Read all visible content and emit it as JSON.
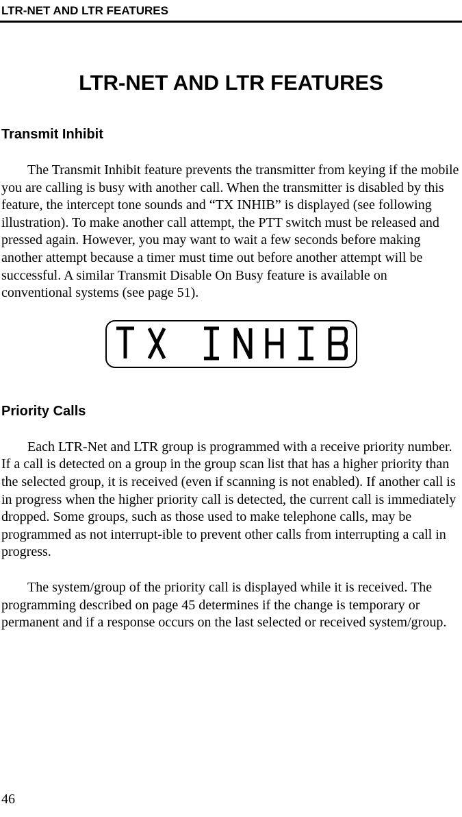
{
  "running_head": "LTR-NET AND LTR FEATURES",
  "title": "LTR-NET AND LTR FEATURES",
  "sections": {
    "transmit_inhibit": {
      "heading": "Transmit Inhibit",
      "para": "The Transmit Inhibit feature prevents the transmitter from keying if the mobile you are calling is busy with another call. When the transmitter is disabled by this feature, the intercept tone sounds and “TX INHIB” is displayed (see following illustration). To make another call attempt, the PTT switch must be released and pressed again. However, you may want to wait a few seconds before making another attempt because a timer must time out before another attempt will be successful. A similar Transmit Disable On Busy feature is available on conventional systems (see page 51)."
    },
    "priority_calls": {
      "heading": "Priority Calls",
      "para1": "Each LTR-Net and LTR group is programmed with a receive priority number. If a call is detected on a group in the group scan list that has a higher priority than the selected group, it is received (even if scanning is not enabled). If another call is in progress when the higher priority call is detected, the current call is immediately dropped. Some groups, such as those used to make telephone calls, may be programmed as not interrupt-ible to prevent other calls from interrupting a call in progress.",
      "para2": "The system/group of the priority call is displayed while it is received. The programming described on page 45 determines if the change is temporary or permanent and if a response occurs on the last selected or received system/group."
    }
  },
  "lcd_text": "TX INHIB",
  "page_number": "46"
}
